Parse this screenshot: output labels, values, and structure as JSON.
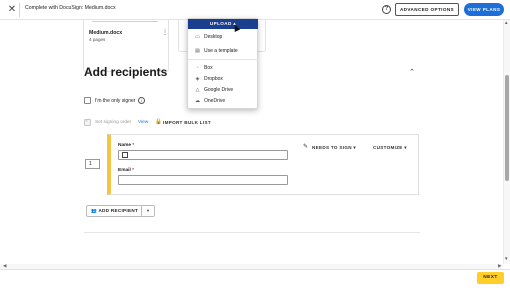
{
  "topbar": {
    "close_glyph": "✕",
    "title": "Complete with DocuSign: Medium.docx",
    "help_glyph": "?",
    "advanced_options": "ADVANCED OPTIONS",
    "view_plans": "VIEW PLANS"
  },
  "document": {
    "name": "Medium.docx",
    "pages": "4 pages",
    "menu_glyph": "⋮"
  },
  "upload_menu": {
    "button_label": "UPLOAD",
    "items": [
      {
        "label": "Desktop",
        "icon": "monitor-icon",
        "glyph": "▭"
      },
      {
        "label": "Use a template",
        "icon": "template-icon",
        "glyph": "▤"
      },
      {
        "label": "Box",
        "icon": "box-icon",
        "glyph": "▫"
      },
      {
        "label": "Dropbox",
        "icon": "dropbox-icon",
        "glyph": "◈"
      },
      {
        "label": "Google Drive",
        "icon": "google-drive-icon",
        "glyph": "△"
      },
      {
        "label": "OneDrive",
        "icon": "onedrive-icon",
        "glyph": "☁"
      }
    ]
  },
  "recipients": {
    "title": "Add recipients",
    "collapse_glyph": "⌃",
    "only_signer_label": "I'm the only signer",
    "info_glyph": "i",
    "signing_order_label": "Set signing order",
    "view_link": "View",
    "import_bulk": "IMPORT BULK LIST",
    "recipient": {
      "order": "1",
      "name_label": "Name",
      "email_label": "Email",
      "required_mark": "*",
      "action": "NEEDS TO SIGN",
      "customize": "CUSTOMIZE"
    },
    "add_recipient": "ADD RECIPIENT"
  },
  "footer": {
    "next": "NEXT"
  },
  "colors": {
    "primary_blue": "#1e6ed8",
    "upload_navy": "#1b3f8f",
    "next_yellow": "#ffce2b",
    "recipient_accent": "#f4c542"
  }
}
